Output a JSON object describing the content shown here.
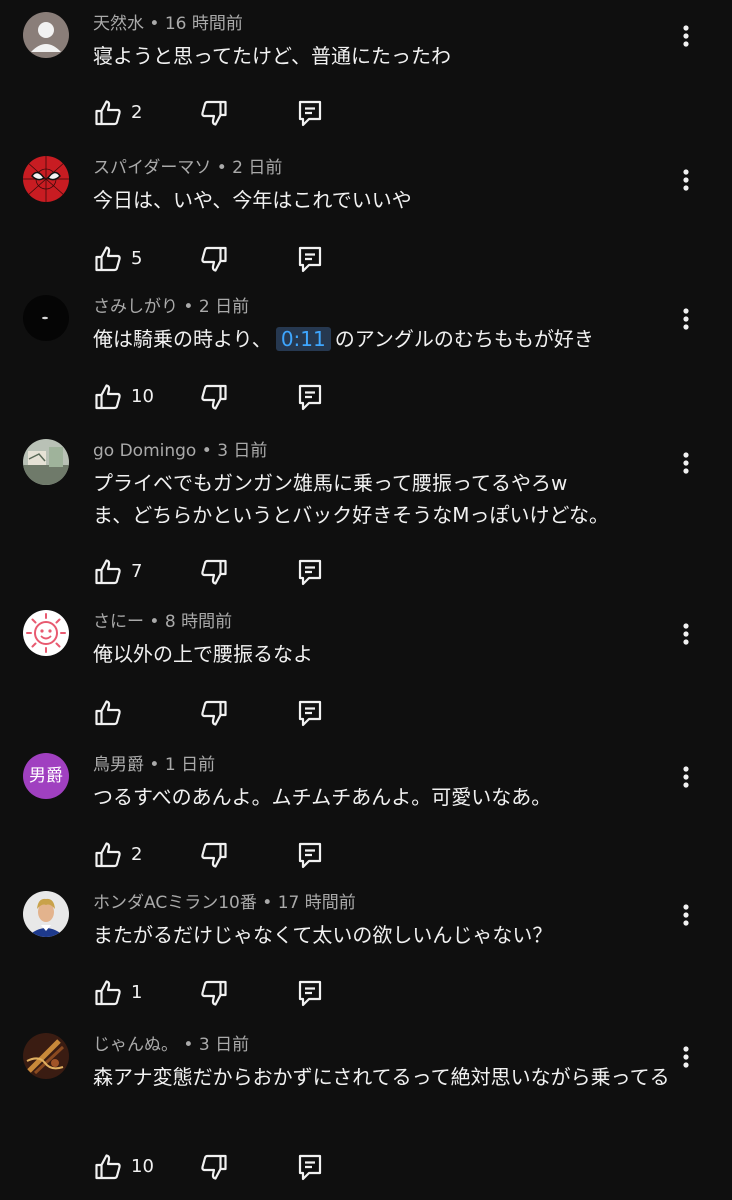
{
  "comments": [
    {
      "author": "天然水",
      "time": "16 時間前",
      "text": [
        "寝ようと思ってたけど、普通にたったわ"
      ],
      "likes": "2",
      "avatar": "default-avatar"
    },
    {
      "author": "スパイダーマソ",
      "time": "2 日前",
      "text": [
        "今日は、いや、今年はこれでいいや"
      ],
      "likes": "5",
      "avatar": "spiderman-avatar"
    },
    {
      "author": "さみしがり",
      "time": "2 日前",
      "text_before": "俺は騎乗の時より、",
      "timestamp_link": "0:11",
      "text_after": "のアングルのむちももが好き",
      "likes": "10",
      "avatar": "dark-avatar"
    },
    {
      "author": "go Domingo",
      "time": "3 日前",
      "text": [
        "プライベでもガンガン雄馬に乗って腰振ってるやろw",
        "ま、どちらかというとバック好きそうなMっぽいけどな。"
      ],
      "likes": "7",
      "avatar": "photo-avatar"
    },
    {
      "author": "さにー",
      "time": "8 時間前",
      "text": [
        "俺以外の上で腰振るなよ"
      ],
      "likes": "",
      "avatar": "sun-face-avatar"
    },
    {
      "author": "鳥男爵",
      "time": "1 日前",
      "text": [
        "つるすべのあんよ。ムチムチあんよ。可愛いなあ。"
      ],
      "likes": "2",
      "avatar": "initials-avatar",
      "avatar_label": "男爵",
      "avatar_color": "#a040c0"
    },
    {
      "author": "ホンダACミラン10番",
      "time": "17 時間前",
      "text": [
        "またがるだけじゃなくて太いの欲しいんじゃない？"
      ],
      "likes": "1",
      "avatar": "person-avatar"
    },
    {
      "author": "じゃんぬ。",
      "time": "3 日前",
      "text": [
        "森アナ変態だからおかずにされてるって絶対思いながら乗ってる"
      ],
      "likes": "10",
      "avatar": "art-avatar"
    }
  ],
  "meta_separator": " • ",
  "colors": {
    "background": "#0f0f0f",
    "text": "#f1f1f1",
    "meta": "#aaaaaa",
    "link": "#3ea6ff"
  },
  "icons": {
    "like": "thumbs-up-icon",
    "dislike": "thumbs-down-icon",
    "reply": "reply-icon",
    "more": "more-vert-icon"
  }
}
